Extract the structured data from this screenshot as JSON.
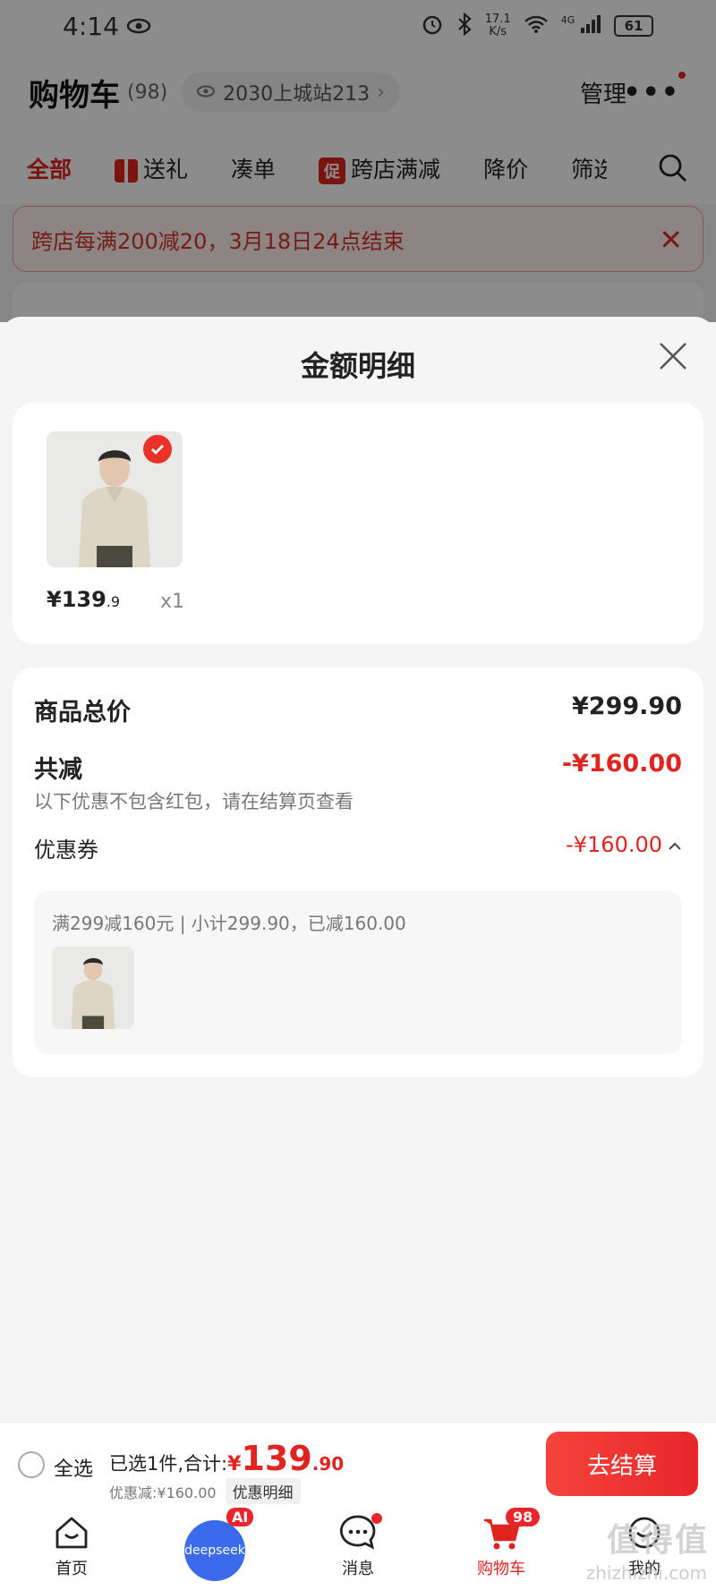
{
  "status_bar": {
    "time": "4:14",
    "net_speed_top": "17.1",
    "net_speed_bottom": "K/s",
    "network": "4G",
    "battery": "61"
  },
  "header": {
    "title": "购物车",
    "count": "(98)",
    "location": "2030上城站213",
    "manage": "管理"
  },
  "tabs": [
    {
      "label": "全部"
    },
    {
      "label": "送礼"
    },
    {
      "label": "凑单"
    },
    {
      "label": "跨店满减",
      "badge": "促"
    },
    {
      "label": "降价"
    },
    {
      "label": "筛选"
    }
  ],
  "promo_banner": {
    "text": "跨店每满200减20，3月18日24点结束"
  },
  "sheet": {
    "title": "金额明细",
    "item": {
      "price_main": "¥139",
      "price_dec": ".9",
      "qty": "x1"
    },
    "summary": {
      "total_label": "商品总价",
      "total_value": "¥299.90",
      "reduce_label": "共减",
      "reduce_value": "-¥160.00",
      "reduce_note": "以下优惠不包含红包，请在结算页查看",
      "coupon_label": "优惠券",
      "coupon_value": "-¥160.00",
      "coupon_detail": "满299减160元 | 小计299.90，已减160.00"
    }
  },
  "checkout": {
    "select_all": "全选",
    "selected_text": "已选1件,合计:",
    "total_yen": "¥",
    "total_main": "139",
    "total_dec": ".90",
    "discount_text": "优惠减:¥160.00",
    "detail_chip": "优惠明细",
    "button": "去结算"
  },
  "tabbar": [
    {
      "label": "首页"
    },
    {
      "label": "deepseek",
      "badge": "AI"
    },
    {
      "label": "消息"
    },
    {
      "label": "购物车",
      "badge": "98"
    },
    {
      "label": "我的"
    }
  ],
  "watermark": {
    "text": "值得值",
    "sub": "zhizhizhi.com"
  },
  "colors": {
    "accent": "#e0241f",
    "checkout_button": "#f4443a",
    "deepseek": "#3b6bea"
  }
}
